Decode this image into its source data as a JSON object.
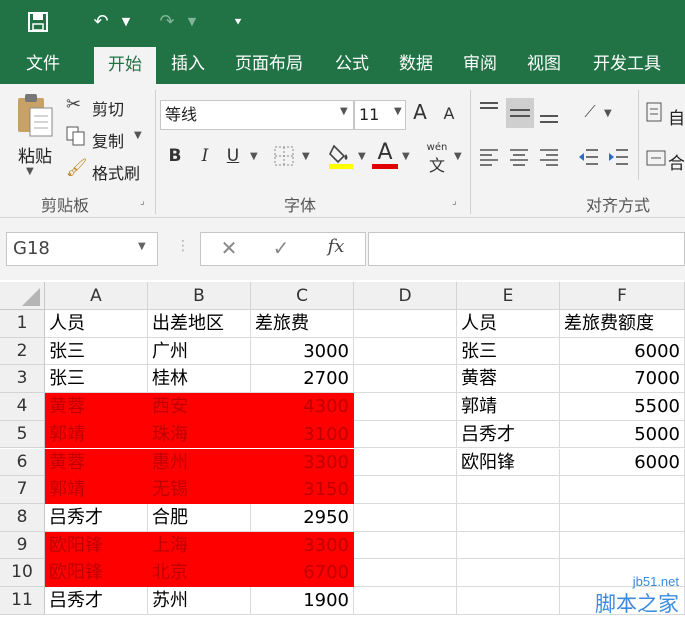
{
  "app": {
    "quick_access": {
      "save_icon": "save-icon",
      "undo_icon": "undo-icon",
      "redo_icon": "redo-icon",
      "customize_icon": "customize-icon"
    },
    "tabs": [
      "文件",
      "开始",
      "插入",
      "页面布局",
      "公式",
      "数据",
      "审阅",
      "视图",
      "开发工具"
    ],
    "active_tab": "开始",
    "accent_color": "#217346"
  },
  "ribbon": {
    "clipboard": {
      "paste": "粘贴",
      "cut": "剪切",
      "copy": "复制",
      "format_painter": "格式刷",
      "group_label": "剪贴板"
    },
    "font": {
      "font_name": "等线",
      "font_size": "11",
      "grow": "A",
      "shrink": "A",
      "bold": "B",
      "italic": "I",
      "underline": "U",
      "pinyin": "wén",
      "pinyin_char": "文",
      "font_color": "A",
      "group_label": "字体"
    },
    "alignment": {
      "group_label": "对齐方式",
      "wrap_partial": "自",
      "merge_partial": "合"
    }
  },
  "formula_bar": {
    "name_box": "G18",
    "cancel": "✕",
    "enter": "✓",
    "fx": "fx",
    "formula": ""
  },
  "sheet": {
    "columns": [
      "A",
      "B",
      "C",
      "D",
      "E",
      "F"
    ],
    "rows": [
      {
        "num": "1",
        "A": "人员",
        "B": "出差地区",
        "C": "差旅费",
        "E": "人员",
        "F": "差旅费额度",
        "highlight": false
      },
      {
        "num": "2",
        "A": "张三",
        "B": "广州",
        "C": "3000",
        "E": "张三",
        "F": "6000",
        "highlight": false
      },
      {
        "num": "3",
        "A": "张三",
        "B": "桂林",
        "C": "2700",
        "E": "黄蓉",
        "F": "7000",
        "highlight": false
      },
      {
        "num": "4",
        "A": "黄蓉",
        "B": "西安",
        "C": "4300",
        "E": "郭靖",
        "F": "5500",
        "highlight": true
      },
      {
        "num": "5",
        "A": "郭靖",
        "B": "珠海",
        "C": "3100",
        "E": "吕秀才",
        "F": "5000",
        "highlight": true
      },
      {
        "num": "6",
        "A": "黄蓉",
        "B": "惠州",
        "C": "3300",
        "E": "欧阳锋",
        "F": "6000",
        "highlight": true
      },
      {
        "num": "7",
        "A": "郭靖",
        "B": "无锡",
        "C": "3150",
        "E": "",
        "F": "",
        "highlight": true
      },
      {
        "num": "8",
        "A": "吕秀才",
        "B": "合肥",
        "C": "2950",
        "E": "",
        "F": "",
        "highlight": false
      },
      {
        "num": "9",
        "A": "欧阳锋",
        "B": "上海",
        "C": "3300",
        "E": "",
        "F": "",
        "highlight": true
      },
      {
        "num": "10",
        "A": "欧阳锋",
        "B": "北京",
        "C": "6700",
        "E": "",
        "F": "",
        "highlight": true
      },
      {
        "num": "11",
        "A": "吕秀才",
        "B": "苏州",
        "C": "1900",
        "E": "",
        "F": "",
        "highlight": false
      }
    ],
    "highlight_fill": "#ff0000",
    "highlight_text": "#c00000"
  },
  "watermark": {
    "site": "jb51.net",
    "name": "脚本之家"
  }
}
